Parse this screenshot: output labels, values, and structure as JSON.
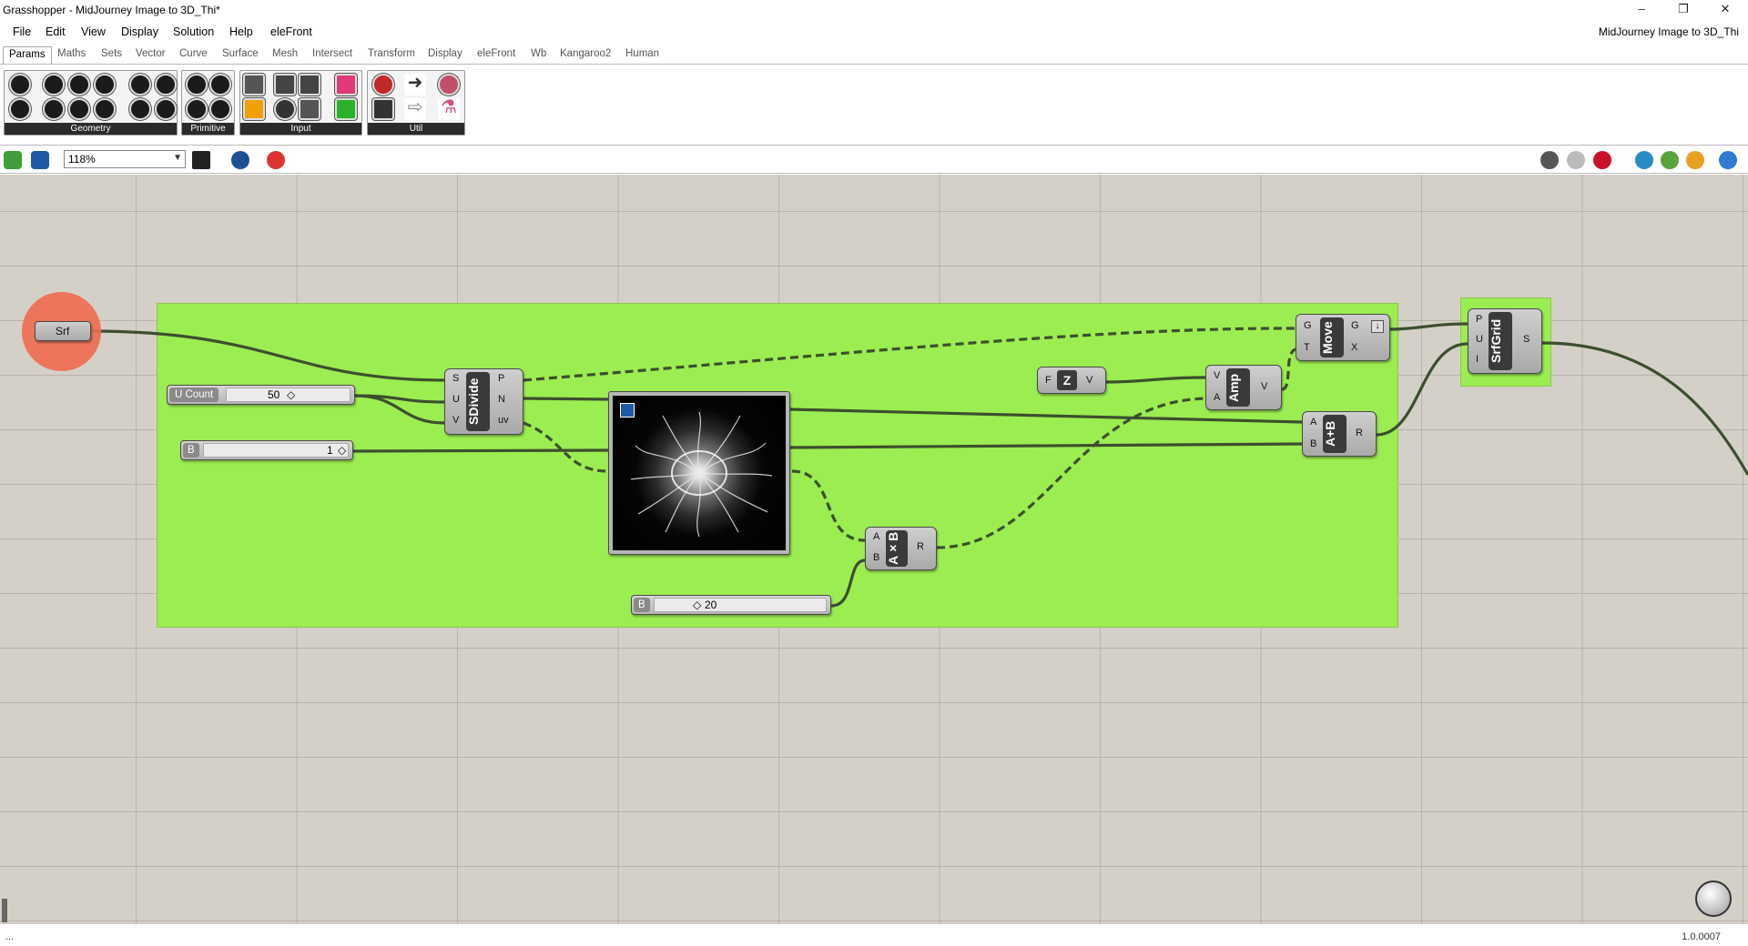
{
  "window": {
    "title": "Grasshopper - MidJourney Image to 3D_Thi*",
    "doc_title": "MidJourney Image to 3D_Thi",
    "minimize": "–",
    "restore": "❐",
    "close": "✕"
  },
  "menu": [
    "File",
    "Edit",
    "View",
    "Display",
    "Solution",
    "Help",
    "eleFront"
  ],
  "tabs": [
    "Params",
    "Maths",
    "Sets",
    "Vector",
    "Curve",
    "Surface",
    "Mesh",
    "Intersect",
    "Transform",
    "Display",
    "eleFront",
    "Wb",
    "Kangaroo2",
    "Human"
  ],
  "active_tab": "Params",
  "ribbon_panels": [
    "Geometry",
    "Primitive",
    "Input",
    "Util"
  ],
  "zoom": "118%",
  "canvas": {
    "srf_param": "Srf",
    "u_count": {
      "name": "U Count",
      "value": "50"
    },
    "b_slider_1": {
      "name": "B",
      "value": "1"
    },
    "b_slider_2": {
      "name": "B",
      "value": "20"
    },
    "sdivide": {
      "nick": "SDivide",
      "inputs": [
        "S",
        "U",
        "V"
      ],
      "outputs": [
        "P",
        "N",
        "uv"
      ]
    },
    "unit_z": {
      "nick": "Z",
      "inputs": [
        "F"
      ],
      "outputs": [
        "V"
      ]
    },
    "amplitude": {
      "nick": "Amp",
      "inputs": [
        "V",
        "A"
      ],
      "outputs": [
        "V"
      ]
    },
    "move": {
      "nick": "Move",
      "inputs": [
        "G",
        "T"
      ],
      "outputs": [
        "G",
        "X"
      ]
    },
    "addition": {
      "nick": "A+B",
      "inputs": [
        "A",
        "B"
      ],
      "outputs": [
        "R"
      ]
    },
    "multiply": {
      "nick": "A×B",
      "inputs": [
        "A",
        "B"
      ],
      "outputs": [
        "R"
      ]
    },
    "srfgrid": {
      "nick": "SrfGrid",
      "inputs": [
        "P",
        "U",
        "I"
      ],
      "outputs": [
        "S"
      ]
    }
  },
  "status": {
    "left": "...",
    "version": "1.0.0007"
  },
  "colors": {
    "group": "#9ced51",
    "canvas": "#d4d0c8",
    "selected_param": "#ef6a4f"
  }
}
